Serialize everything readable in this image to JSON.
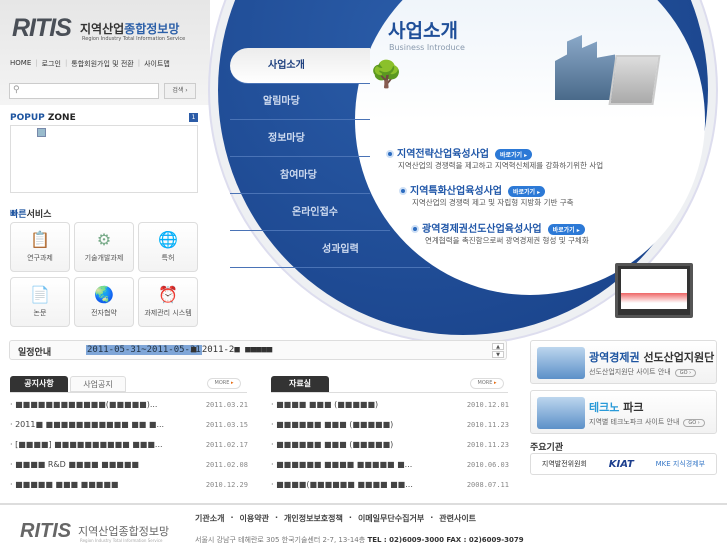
{
  "header": {
    "logo": "RITIS",
    "logo_kr_a": "지역산업",
    "logo_kr_b": "종합정보망",
    "logo_en": "Region Industry Total Information Service",
    "nav": [
      "HOME",
      "로그인",
      "통합회원가입 및 전환",
      "사이트맵"
    ]
  },
  "search": {
    "placeholder": "",
    "button": "검색 ›"
  },
  "popup": {
    "title_a": "POPUP",
    "title_b": " ZONE",
    "count": "1"
  },
  "quick": {
    "title_a": "빠른",
    "title_b": "서비스",
    "items": [
      {
        "label": "연구과제",
        "icon": "clipboard-icon"
      },
      {
        "label": "기술개발과제",
        "icon": "gear-icon"
      },
      {
        "label": "특허",
        "icon": "globe-icon"
      },
      {
        "label": "논문",
        "icon": "paper-icon"
      },
      {
        "label": "전자협약",
        "icon": "globe-chart-icon"
      },
      {
        "label": "과제관리 시스템",
        "icon": "clock-icon"
      }
    ]
  },
  "menu": [
    "사업소개",
    "알림마당",
    "정보마당",
    "참여마당",
    "온라인접수",
    "성과입력"
  ],
  "intro": {
    "title": "사업소개",
    "subtitle": "Business Introduce",
    "go": "바로가기 ▸",
    "items": [
      {
        "title": "지역전략산업육성사업",
        "desc": "지역산업의 경쟁력을 제고하고 지역혁신체제를 강화하기위한 사업"
      },
      {
        "title": "지역특화산업육성사업",
        "desc": "지역산업의 경쟁력 제고 및 자립형 지방화 기반 구축"
      },
      {
        "title": "광역경제권선도산업육성사업",
        "desc": "연계협력을 촉진함으로써 광역경제권 형성 및 구체화"
      }
    ]
  },
  "schedule": {
    "label": "일정안내",
    "selected": "2011-05-31~2011-05-31",
    "rest": "■ 2011-2■ ■■■■■"
  },
  "notice": {
    "tabs": [
      "공지사항",
      "사업공지"
    ],
    "more": "MORE",
    "items": [
      {
        "title": "■■■■■■■■■■■■(■■■■■)...",
        "date": "2011.03.21"
      },
      {
        "title": "2011■ ■■■■■■■■■■■ ■■ ■...",
        "date": "2011.03.15"
      },
      {
        "title": "[■■■■] ■■■■■■■■■■ ■■■...",
        "date": "2011.02.17"
      },
      {
        "title": "■■■■ R&D ■■■■ ■■■■■",
        "date": "2011.02.08"
      },
      {
        "title": "■■■■■ ■■■ ■■■■■",
        "date": "2010.12.29"
      }
    ]
  },
  "archive": {
    "tab": "자료실",
    "more": "MORE",
    "items": [
      {
        "title": "■■■■ ■■■ (■■■■■)",
        "date": "2010.12.01"
      },
      {
        "title": "■■■■■■ ■■■ (■■■■■)",
        "date": "2010.11.23"
      },
      {
        "title": "■■■■■■ ■■■ (■■■■■)",
        "date": "2010.11.23"
      },
      {
        "title": "■■■■■■ ■■■■ ■■■■■ ■...",
        "date": "2010.06.03"
      },
      {
        "title": "■■■■(■■■■■■ ■■■■ ■■...",
        "date": "2008.07.11"
      }
    ]
  },
  "banners": [
    {
      "t_a": "광역경제권",
      "t_b": " 선도산업지원단",
      "desc": "선도산업지원단 사이트 안내",
      "go": "GO ›"
    },
    {
      "t_a": "테크노",
      "t_b": " 파크",
      "desc": "지역별 테크노파크 사이트 안내",
      "go": "GO ›"
    }
  ],
  "orgs": {
    "title": "주요기관",
    "items": [
      "지역발전위원회",
      "KIAT",
      "MKE 지식경제부"
    ]
  },
  "footer": {
    "logo": "RITIS",
    "kr": "지역산업종합정보망",
    "en": "Region Industry Total Information Service",
    "links": [
      "기관소개",
      "이용약관",
      "개인정보보호정책",
      "이메일무단수집거부",
      "관련사이트"
    ],
    "address": "서울시 강남구 테헤란로 305 한국기술센터 2-7, 13-14층",
    "contact": "TEL : 02)6009-3000 FAX : 02)6009-3079"
  }
}
